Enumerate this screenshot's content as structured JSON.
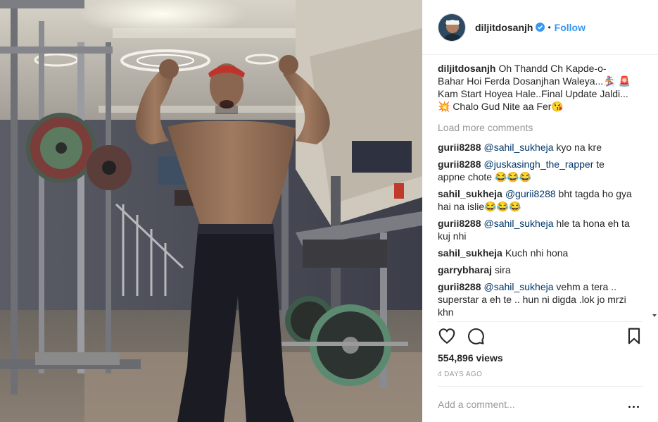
{
  "post": {
    "username": "diljitdosanjh",
    "verified": true,
    "dot": "•",
    "follow_label": "Follow",
    "caption_user": "diljitdosanjh",
    "caption_text": "Oh Thandd Ch Kapde-o-Bahar Hoi Ferda Dosanjhan Waleya...🏂 🚨Kam Start Hoyea Hale..Final Update Jaldi...💥 Chalo Gud Nite aa Fer😘",
    "load_more": "Load more comments",
    "comments": [
      {
        "user": "gurii8288",
        "mention": "@sahil_sukheja",
        "text": " kyo na kre"
      },
      {
        "user": "gurii8288",
        "mention": "@juskasingh_the_rapper",
        "text": " te appne chote 😂😂😂"
      },
      {
        "user": "sahil_sukheja",
        "mention": "@gurii8288",
        "text": " bht tagda ho gya hai na islie😂😂😂"
      },
      {
        "user": "gurii8288",
        "mention": "@sahil_sukheja",
        "text": " hle ta hona eh ta kuj nhi"
      },
      {
        "user": "sahil_sukheja",
        "mention": "",
        "text": "Kuch nhi hona"
      },
      {
        "user": "garrybharaj",
        "mention": "",
        "text": "sira"
      },
      {
        "user": "gurii8288",
        "mention": "@sahil_sukheja",
        "text": " vehm a tera .. superstar a eh te .. hun ni digda .lok jo mrzi khn"
      }
    ],
    "views": "554,896 views",
    "date": "4 DAYS AGO",
    "add_comment_placeholder": "Add a comment...",
    "icons": {
      "like": "heart-icon",
      "comment": "comment-bubble-icon",
      "save": "bookmark-icon",
      "more": "more-dots-icon",
      "verified": "verified-badge-icon"
    },
    "colors": {
      "link": "#3897f0",
      "mention": "#003569",
      "muted": "#999999",
      "text": "#262626"
    }
  }
}
